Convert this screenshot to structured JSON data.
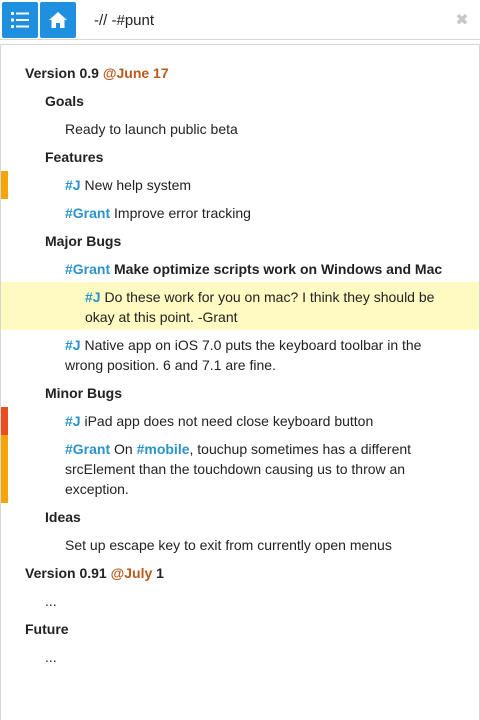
{
  "search": {
    "value": "-// -#punt"
  },
  "colors": {
    "accent": "#1f8fe0",
    "tag": "#2a93c9",
    "date": "#b85a1a",
    "highlight": "#fff9c2",
    "marker_orange": "#f5a50a",
    "marker_red": "#ec4d1f"
  },
  "outline": {
    "v09": {
      "title": "Version 0.9",
      "date": "@June 17"
    },
    "goals": {
      "title": "Goals",
      "item": "Ready to launch public beta"
    },
    "features": {
      "title": "Features",
      "item1": {
        "tag": "#J",
        "text": "New help system"
      },
      "item2": {
        "tag": "#Grant",
        "text": "Improve error tracking"
      }
    },
    "major": {
      "title": "Major Bugs",
      "item1": {
        "tag": "#Grant",
        "text": "Make optimize scripts work on Windows and Mac"
      },
      "reply": {
        "tag": "#J",
        "text": "Do these work for you on mac? I think they should be",
        "text2": "okay at this point. -Grant"
      },
      "item2": {
        "tag": "#J",
        "text": "Native app on iOS 7.0 puts the keyboard toolbar in the",
        "text2": "wrong position. 6 and 7.1 are fine."
      }
    },
    "minor": {
      "title": "Minor Bugs",
      "item1": {
        "tag": "#J",
        "text": "iPad app does not need close keyboard button"
      },
      "item2": {
        "tag": "#Grant",
        "pre": "On",
        "tag2": "#mobile",
        "text": ", touchup sometimes has a different",
        "text2": "srcElement than the touchdown causing us to throw an",
        "text3": "exception."
      }
    },
    "ideas": {
      "title": "Ideas",
      "item": "Set up escape key to exit from currently open menus"
    },
    "v091": {
      "title": "Version 0.91",
      "date": "@July",
      "date_suffix": "1",
      "child": "..."
    },
    "future": {
      "title": "Future",
      "child": "..."
    }
  }
}
